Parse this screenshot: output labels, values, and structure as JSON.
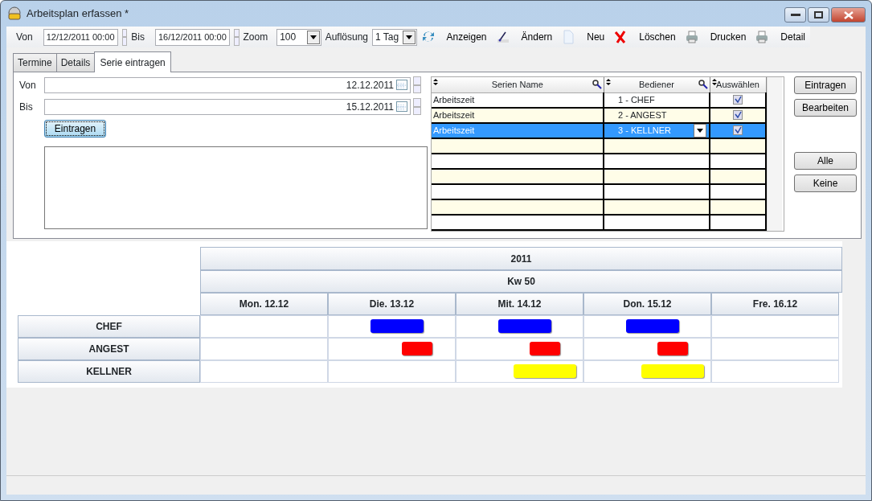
{
  "window": {
    "title": "Arbeitsplan erfassen *"
  },
  "toolbar": {
    "von_label": "Von",
    "von_value": "12/12/2011 00:00",
    "bis_label": "Bis",
    "bis_value": "16/12/2011 00:00",
    "zoom_label": "Zoom",
    "zoom_value": "100",
    "resolution_label": "Auflösung",
    "resolution_value": "1 Tag",
    "buttons": [
      {
        "kind": "refresh",
        "label": "Anzeigen"
      },
      {
        "kind": "edit",
        "label": "Ändern"
      },
      {
        "kind": "new",
        "label": "Neu"
      },
      {
        "kind": "delete",
        "label": "Löschen"
      },
      {
        "kind": "print",
        "label": "Drucken"
      },
      {
        "kind": "print",
        "label": "Detail"
      }
    ]
  },
  "tabs": [
    {
      "label": "Termine",
      "selected": false
    },
    {
      "label": "Details",
      "selected": false
    },
    {
      "label": "Serie eintragen",
      "selected": true
    }
  ],
  "form": {
    "von_label": "Von",
    "von_value": "12.12.2011",
    "bis_label": "Bis",
    "bis_value": "15.12.2011",
    "button": "Eintragen"
  },
  "series_table": {
    "columns": [
      "Serien Name",
      "Bediener",
      "Auswählen"
    ],
    "rows": [
      {
        "name": "Arbeitszeit",
        "operator": "1 - CHEF",
        "checked": true,
        "selected": false
      },
      {
        "name": "Arbeitszeit",
        "operator": "2 - ANGEST",
        "checked": true,
        "selected": false
      },
      {
        "name": "Arbeitszeit",
        "operator": "3 - KELLNER",
        "checked": true,
        "selected": true
      }
    ]
  },
  "side_buttons": [
    "Eintragen",
    "Bearbeiten",
    "Alle",
    "Keine"
  ],
  "schedule": {
    "year": "2011",
    "week": "Kw 50",
    "days": [
      "Mon. 12.12",
      "Die. 13.12",
      "Mit. 14.12",
      "Don. 15.12",
      "Fre. 16.12"
    ],
    "resources": [
      {
        "name": "CHEF",
        "color": "#0000ff",
        "booked": [
          false,
          true,
          true,
          true,
          false
        ]
      },
      {
        "name": "ANGEST",
        "color": "#ff0000",
        "booked": [
          false,
          true,
          true,
          true,
          false
        ]
      },
      {
        "name": "KELLNER",
        "color": "#ffff00",
        "booked": [
          false,
          false,
          true,
          true,
          false
        ]
      }
    ]
  }
}
